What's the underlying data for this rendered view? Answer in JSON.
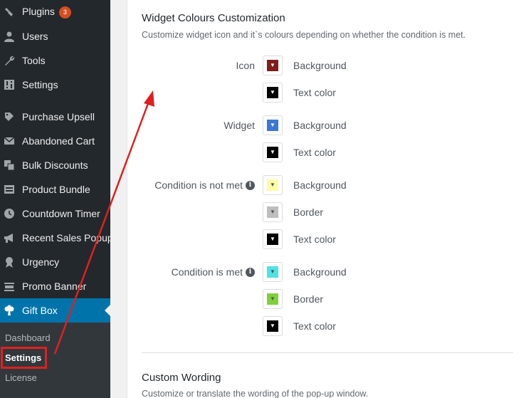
{
  "sidebar": {
    "items": [
      {
        "label": "Plugins",
        "icon": "plugin-icon",
        "badge": "3"
      },
      {
        "label": "Users",
        "icon": "users-icon"
      },
      {
        "label": "Tools",
        "icon": "wrench-icon"
      },
      {
        "label": "Settings",
        "icon": "settings-icon"
      },
      {
        "label": "Purchase Upsell",
        "icon": "tag-icon"
      },
      {
        "label": "Abandoned Cart",
        "icon": "envelope-icon"
      },
      {
        "label": "Bulk Discounts",
        "icon": "discount-icon"
      },
      {
        "label": "Product Bundle",
        "icon": "bundle-icon"
      },
      {
        "label": "Countdown Timer",
        "icon": "clock-icon"
      },
      {
        "label": "Recent Sales Popup",
        "icon": "megaphone-icon"
      },
      {
        "label": "Urgency",
        "icon": "award-icon"
      },
      {
        "label": "Promo Banner",
        "icon": "banner-icon"
      },
      {
        "label": "Gift Box",
        "icon": "gift-icon"
      }
    ],
    "submenu": [
      "Dashboard",
      "Settings",
      "License"
    ]
  },
  "widget_colours": {
    "title": "Widget Colours Customization",
    "description": "Customize widget icon and it`s colours depending on whether the condition is met.",
    "groups": [
      {
        "label": "Icon",
        "info": false,
        "rows": [
          {
            "label": "Background",
            "color": "#7f1d1d"
          },
          {
            "label": "Text color",
            "color": "#000000"
          }
        ]
      },
      {
        "label": "Widget",
        "info": false,
        "rows": [
          {
            "label": "Background",
            "color": "#3b78d4"
          },
          {
            "label": "Text color",
            "color": "#000000"
          }
        ]
      },
      {
        "label": "Condition is not met",
        "info": true,
        "rows": [
          {
            "label": "Background",
            "color": "#fdfda6"
          },
          {
            "label": "Border",
            "color": "#bdbdbd"
          },
          {
            "label": "Text color",
            "color": "#000000"
          }
        ]
      },
      {
        "label": "Condition is met",
        "info": true,
        "rows": [
          {
            "label": "Background",
            "color": "#4de3e3"
          },
          {
            "label": "Border",
            "color": "#7ed13c"
          },
          {
            "label": "Text color",
            "color": "#000000"
          }
        ]
      }
    ]
  },
  "custom_wording": {
    "title": "Custom Wording",
    "description": "Customize or translate the wording of the pop-up window."
  },
  "colors": {
    "sidebar_bg": "#23282d",
    "active": "#0073aa",
    "badge": "#d54e21",
    "annotation": "#e02020"
  }
}
